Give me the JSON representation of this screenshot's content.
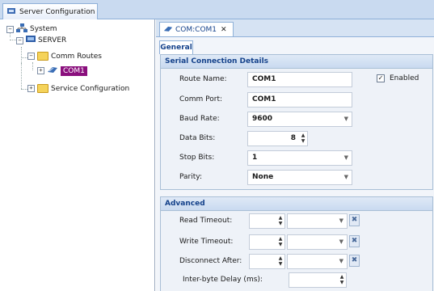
{
  "window_tab": {
    "label": "Server Configuration",
    "icon": "server-config-icon"
  },
  "tree": {
    "root": "System",
    "server": "SERVER",
    "comm_routes": "Comm Routes",
    "com1": "COM1",
    "service_configuration": "Service Configuration"
  },
  "document_tab": {
    "label": "COM:COM1",
    "close_glyph": "✕"
  },
  "general_tab": "General",
  "serial": {
    "title": "Serial Connection Details",
    "route_name_label": "Route Name:",
    "route_name_value": "COM1",
    "enabled_label": "Enabled",
    "enabled_checked": true,
    "comm_port_label": "Comm Port:",
    "comm_port_value": "COM1",
    "baud_rate_label": "Baud Rate:",
    "baud_rate_value": "9600",
    "data_bits_label": "Data Bits:",
    "data_bits_value": "8",
    "stop_bits_label": "Stop Bits:",
    "stop_bits_value": "1",
    "parity_label": "Parity:",
    "parity_value": "None"
  },
  "advanced": {
    "title": "Advanced",
    "read_timeout_label": "Read Timeout:",
    "write_timeout_label": "Write Timeout:",
    "disconnect_after_label": "Disconnect After:",
    "inter_byte_delay_label": "Inter-byte Delay (ms):"
  },
  "colors": {
    "selection": "#8a0f7d",
    "header_text": "#15428b",
    "panel_bg": "#d6e3f3"
  }
}
